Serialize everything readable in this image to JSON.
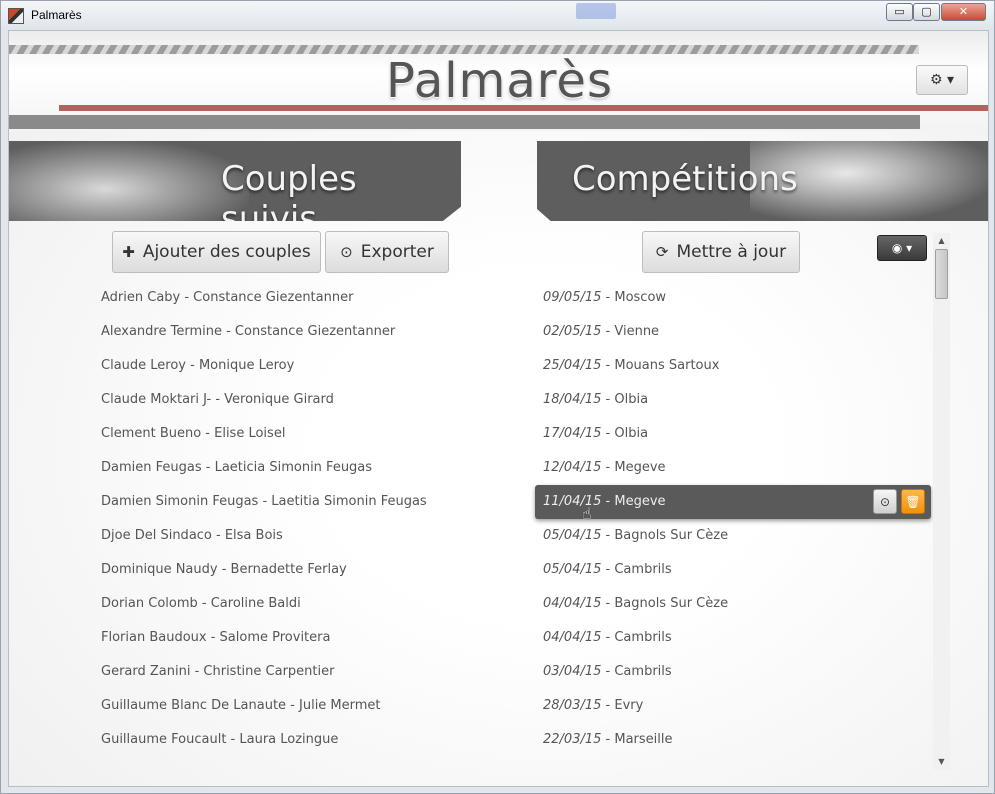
{
  "window": {
    "title": "Palmarès",
    "controls": {
      "minimize": "▭",
      "maximize": "▢",
      "close": "✕"
    }
  },
  "header": {
    "title": "Palmarès",
    "settings_icon": "gear-icon"
  },
  "panels": {
    "couples_title": "Couples suivis",
    "competitions_title": "Compétitions"
  },
  "toolbar": {
    "add_label": "Ajouter des couples",
    "export_label": "Exporter",
    "update_label": "Mettre à jour"
  },
  "couples": [
    "Adrien Caby - Constance Giezentanner",
    "Alexandre Termine - Constance Giezentanner",
    "Claude Leroy - Monique Leroy",
    "Claude Moktari J- - Veronique Girard",
    "Clement Bueno - Elise Loisel",
    "Damien Feugas - Laeticia Simonin Feugas",
    "Damien Simonin Feugas - Laetitia Simonin Feugas",
    "Djoe Del Sindaco - Elsa Bois",
    "Dominique Naudy - Bernadette Ferlay",
    "Dorian Colomb - Caroline Baldi",
    "Florian Baudoux - Salome Provitera",
    "Gerard Zanini - Christine Carpentier",
    "Guillaume Blanc De Lanaute - Julie Mermet",
    "Guillaume Foucault - Laura Lozingue"
  ],
  "competitions": [
    {
      "date": "09/05/15",
      "place": "Moscow"
    },
    {
      "date": "02/05/15",
      "place": "Vienne"
    },
    {
      "date": "25/04/15",
      "place": "Mouans Sartoux"
    },
    {
      "date": "18/04/15",
      "place": "Olbia"
    },
    {
      "date": "17/04/15",
      "place": "Olbia"
    },
    {
      "date": "12/04/15",
      "place": "Megeve"
    },
    {
      "date": "11/04/15",
      "place": "Megeve",
      "active": true
    },
    {
      "date": "05/04/15",
      "place": "Bagnols Sur Cèze"
    },
    {
      "date": "05/04/15",
      "place": "Cambrils"
    },
    {
      "date": "04/04/15",
      "place": "Bagnols Sur Cèze"
    },
    {
      "date": "04/04/15",
      "place": "Cambrils"
    },
    {
      "date": "03/04/15",
      "place": "Cambrils"
    },
    {
      "date": "28/03/15",
      "place": "Evry"
    },
    {
      "date": "22/03/15",
      "place": "Marseille"
    }
  ]
}
